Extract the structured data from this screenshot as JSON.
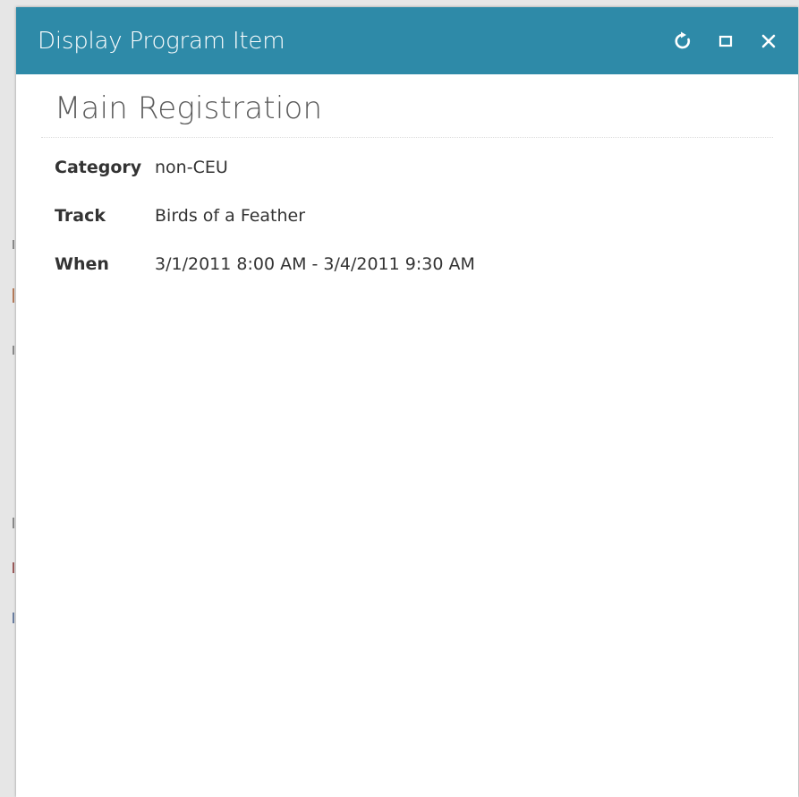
{
  "window": {
    "title": "Display Program Item"
  },
  "icons": {
    "refresh": "refresh-icon",
    "maximize": "maximize-icon",
    "close": "close-icon"
  },
  "item": {
    "title": "Main Registration",
    "details": [
      {
        "label": "Category",
        "value": "non-CEU"
      },
      {
        "label": "Track",
        "value": "Birds of a Feather"
      },
      {
        "label": "When",
        "value": "3/1/2011 8:00 AM - 3/4/2011 9:30 AM"
      }
    ]
  },
  "colors": {
    "titlebar": "#2e8aa8",
    "title_text": "#ffffff",
    "heading_text": "#595959",
    "body_text": "#333333"
  }
}
